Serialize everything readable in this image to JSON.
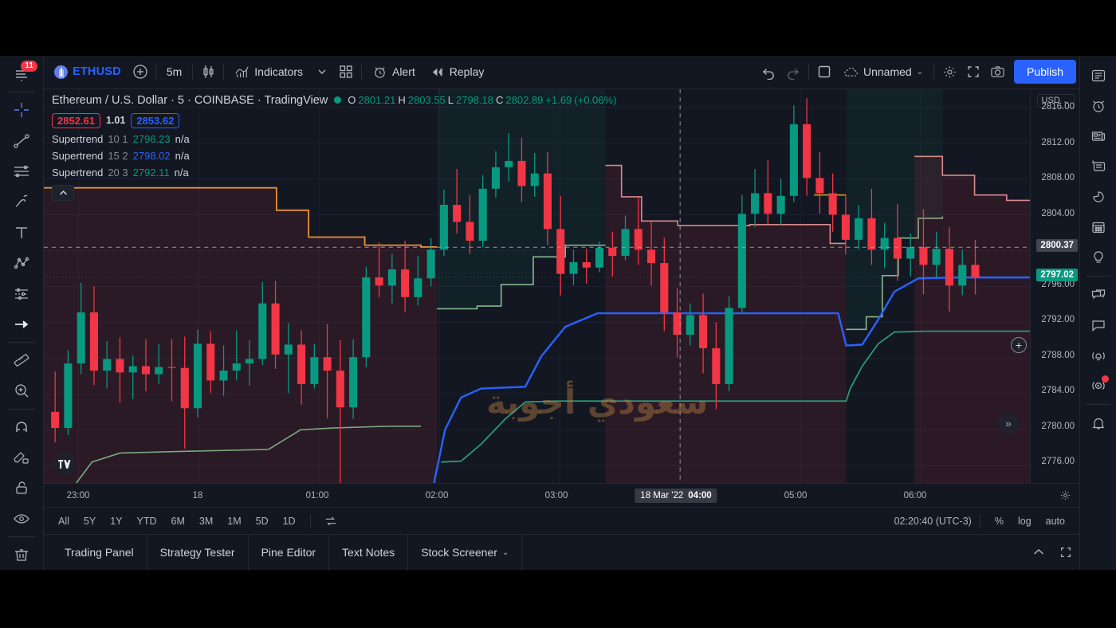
{
  "app": {
    "name": "TradingView",
    "theme_bg": "#131722",
    "accent": "#2962ff",
    "up_color": "#089981",
    "down_color": "#f23645"
  },
  "toolbar": {
    "symbol": "ETHUSD",
    "symbol_icon": "ethereum-coin-icon",
    "add_symbol": "+",
    "interval": "5m",
    "chart_type_icon": "candles-icon",
    "indicators_label": "Indicators",
    "indicators_caret": "⌄",
    "templates_icon": "grid-icon",
    "alert_label": "Alert",
    "replay_label": "Replay",
    "undo_icon": "undo-icon",
    "redo_icon": "redo-icon",
    "layout_icon": "layout-icon",
    "save_state": "Unnamed",
    "save_caret": "⌄",
    "settings_icon": "gear-icon",
    "fullscreen_icon": "fullscreen-icon",
    "snapshot_icon": "camera-icon",
    "publish_label": "Publish"
  },
  "left_tools": [
    {
      "name": "menu-icon",
      "badge": "11"
    },
    {
      "name": "crosshair-icon",
      "badge": ""
    },
    {
      "name": "trend-line-icon",
      "badge": ""
    },
    {
      "name": "horizontal-lines-icon",
      "badge": ""
    },
    {
      "name": "brush-icon",
      "badge": ""
    },
    {
      "name": "text-tool-icon",
      "badge": ""
    },
    {
      "name": "patterns-icon",
      "badge": ""
    },
    {
      "name": "prediction-icon",
      "badge": ""
    },
    {
      "name": "arrow-icon",
      "badge": ""
    },
    {
      "name": "measure-ruler-icon",
      "badge": ""
    },
    {
      "name": "zoom-in-icon",
      "badge": ""
    },
    {
      "name": "magnet-icon",
      "badge": ""
    },
    {
      "name": "stay-in-drawing-mode-icon",
      "badge": ""
    },
    {
      "name": "lock-drawings-icon",
      "badge": ""
    },
    {
      "name": "hide-drawings-icon",
      "badge": ""
    },
    {
      "name": "remove-drawings-icon",
      "badge": ""
    }
  ],
  "right_tools": [
    {
      "name": "watchlist-icon",
      "dot": false
    },
    {
      "name": "alerts-clock-icon",
      "dot": false
    },
    {
      "name": "news-icon",
      "dot": false
    },
    {
      "name": "data-window-icon",
      "dot": false
    },
    {
      "name": "hotlist-icon",
      "dot": false
    },
    {
      "name": "calendar-icon",
      "dot": false
    },
    {
      "name": "ideas-bulb-icon",
      "dot": false
    },
    {
      "name": "public-chats-icon",
      "dot": false
    },
    {
      "name": "private-chats-icon",
      "dot": false
    },
    {
      "name": "broadcast-icon",
      "dot": false
    },
    {
      "name": "stream-icon",
      "dot": true
    },
    {
      "name": "notifications-bell-icon",
      "dot": false
    }
  ],
  "legend": {
    "title": "Ethereum / U.S. Dollar · 5 · COINBASE · TradingView",
    "live_dot": "market-open-dot",
    "ohlc": {
      "o_label": "O",
      "o": "2801.21",
      "h_label": "H",
      "h": "2803.55",
      "l_label": "L",
      "l": "2798.18",
      "c_label": "C",
      "c": "2802.89",
      "change": "+1.69",
      "change_pct": "(+0.06%)"
    },
    "bid": "2852.61",
    "spread": "1.01",
    "ask": "2853.62",
    "indicators": [
      {
        "name": "Supertrend",
        "params": "10 1",
        "value": "2796.23",
        "value_color": "#089981",
        "extra": "n/a"
      },
      {
        "name": "Supertrend",
        "params": "15 2",
        "value": "2798.02",
        "value_color": "#2962ff",
        "extra": "n/a"
      },
      {
        "name": "Supertrend",
        "params": "20 3",
        "value": "2792.11",
        "value_color": "#089981",
        "extra": "n/a"
      }
    ],
    "collapse_icon": "chevron-up-icon",
    "watermark_logo": "tradingview-logo-icon",
    "overlay_watermark": "سعودي أجوبة"
  },
  "price_axis": {
    "currency": "USD",
    "currency_caret": "⌄",
    "ticks": [
      "2816.00",
      "2812.00",
      "2808.00",
      "2804.00",
      "2800.00",
      "2796.00",
      "2792.00",
      "2788.00",
      "2784.00",
      "2780.00",
      "2776.00"
    ],
    "crosshair_price": "2800.37",
    "last_price": "2797.02"
  },
  "time_axis": {
    "ticks": [
      "23:00",
      "18",
      "01:00",
      "02:00",
      "03:00",
      "05:00",
      "06:00"
    ],
    "active_date": "18 Mar '22",
    "active_time": "04:00",
    "settings_icon": "gear-icon"
  },
  "ranges": {
    "buttons": [
      "1D",
      "5D",
      "1M",
      "3M",
      "6M",
      "YTD",
      "1Y",
      "5Y",
      "All"
    ],
    "goto_icon": "go-to-date-icon",
    "clock": "02:20:40 (UTC-3)",
    "percent_label": "%",
    "log_label": "log",
    "auto_label": "auto"
  },
  "footer": {
    "tabs": [
      {
        "label": "Stock Screener",
        "caret": "⌄"
      },
      {
        "label": "Text Notes",
        "caret": ""
      },
      {
        "label": "Pine Editor",
        "caret": ""
      },
      {
        "label": "Strategy Tester",
        "caret": ""
      },
      {
        "label": "Trading Panel",
        "caret": ""
      }
    ],
    "collapse_icon": "chevron-up-icon",
    "fullscreen_icon": "fullscreen-icon"
  },
  "chart_data": {
    "type": "candlestick",
    "title": "Ethereum / U.S. Dollar · 5 · COINBASE",
    "xlabel": "",
    "ylabel": "USD",
    "ylim": [
      2774.0,
      2818.0
    ],
    "grid": true,
    "legend_position": "top-left",
    "y_ticks": [
      2816.0,
      2812.0,
      2808.0,
      2804.0,
      2800.0,
      2796.0,
      2792.0,
      2788.0,
      2784.0,
      2780.0,
      2776.0
    ],
    "x_ticks": [
      "23:00",
      "18",
      "01:00",
      "02:00",
      "03:00",
      "04:00",
      "05:00",
      "06:00"
    ],
    "last_price": 2797.02,
    "crosshair_price": 2800.37,
    "crosshair_time": "18 Mar '22 04:00",
    "candles": [
      {
        "o": 2782.0,
        "h": 2786.5,
        "c": 2780.2,
        "l": 2778.6
      },
      {
        "o": 2780.2,
        "h": 2788.9,
        "c": 2787.4,
        "l": 2779.4
      },
      {
        "o": 2787.4,
        "h": 2796.4,
        "c": 2793.1,
        "l": 2786.2
      },
      {
        "o": 2793.1,
        "h": 2796.0,
        "c": 2786.6,
        "l": 2785.0
      },
      {
        "o": 2786.6,
        "h": 2789.9,
        "c": 2787.9,
        "l": 2784.6
      },
      {
        "o": 2787.9,
        "h": 2790.3,
        "c": 2786.4,
        "l": 2783.0
      },
      {
        "o": 2786.4,
        "h": 2788.3,
        "c": 2787.1,
        "l": 2783.4
      },
      {
        "o": 2787.1,
        "h": 2790.1,
        "c": 2786.2,
        "l": 2784.3
      },
      {
        "o": 2786.2,
        "h": 2789.6,
        "c": 2787.0,
        "l": 2785.1
      },
      {
        "o": 2787.0,
        "h": 2790.1,
        "c": 2786.9,
        "l": 2783.2
      },
      {
        "o": 2786.9,
        "h": 2790.4,
        "c": 2782.4,
        "l": 2777.9
      },
      {
        "o": 2782.4,
        "h": 2791.2,
        "c": 2789.6,
        "l": 2781.4
      },
      {
        "o": 2789.6,
        "h": 2791.0,
        "c": 2785.5,
        "l": 2784.1
      },
      {
        "o": 2785.5,
        "h": 2789.4,
        "c": 2786.6,
        "l": 2783.8
      },
      {
        "o": 2786.6,
        "h": 2791.1,
        "c": 2787.4,
        "l": 2785.5
      },
      {
        "o": 2787.4,
        "h": 2790.0,
        "c": 2787.9,
        "l": 2784.9
      },
      {
        "o": 2787.9,
        "h": 2796.5,
        "c": 2794.1,
        "l": 2787.2
      },
      {
        "o": 2794.1,
        "h": 2796.6,
        "c": 2788.4,
        "l": 2786.8
      },
      {
        "o": 2788.4,
        "h": 2791.9,
        "c": 2789.5,
        "l": 2784.1
      },
      {
        "o": 2789.5,
        "h": 2791.1,
        "c": 2785.1,
        "l": 2782.8
      },
      {
        "o": 2785.1,
        "h": 2789.6,
        "c": 2788.1,
        "l": 2784.6
      },
      {
        "o": 2788.1,
        "h": 2791.8,
        "c": 2786.6,
        "l": 2781.3
      },
      {
        "o": 2786.6,
        "h": 2790.0,
        "c": 2782.5,
        "l": 2774.0
      },
      {
        "o": 2782.5,
        "h": 2790.1,
        "c": 2788.1,
        "l": 2781.2
      },
      {
        "o": 2788.1,
        "h": 2798.2,
        "c": 2797.0,
        "l": 2787.0
      },
      {
        "o": 2797.0,
        "h": 2800.9,
        "c": 2796.1,
        "l": 2794.8
      },
      {
        "o": 2796.1,
        "h": 2799.6,
        "c": 2797.9,
        "l": 2794.1
      },
      {
        "o": 2797.9,
        "h": 2801.1,
        "c": 2794.8,
        "l": 2793.1
      },
      {
        "o": 2794.8,
        "h": 2799.4,
        "c": 2796.9,
        "l": 2793.9
      },
      {
        "o": 2796.9,
        "h": 2801.4,
        "c": 2800.1,
        "l": 2796.0
      },
      {
        "o": 2800.1,
        "h": 2806.8,
        "c": 2805.1,
        "l": 2799.4
      },
      {
        "o": 2805.1,
        "h": 2809.1,
        "c": 2803.2,
        "l": 2801.9
      },
      {
        "o": 2803.2,
        "h": 2806.2,
        "c": 2801.1,
        "l": 2799.6
      },
      {
        "o": 2801.1,
        "h": 2808.4,
        "c": 2806.9,
        "l": 2800.4
      },
      {
        "o": 2806.9,
        "h": 2811.1,
        "c": 2809.3,
        "l": 2805.9
      },
      {
        "o": 2809.3,
        "h": 2813.1,
        "c": 2810.0,
        "l": 2807.7
      },
      {
        "o": 2810.0,
        "h": 2812.6,
        "c": 2807.2,
        "l": 2805.4
      },
      {
        "o": 2807.2,
        "h": 2810.9,
        "c": 2808.6,
        "l": 2806.0
      },
      {
        "o": 2808.6,
        "h": 2811.0,
        "c": 2802.4,
        "l": 2800.6
      },
      {
        "o": 2802.4,
        "h": 2806.1,
        "c": 2797.4,
        "l": 2795.0
      },
      {
        "o": 2797.4,
        "h": 2800.1,
        "c": 2798.7,
        "l": 2796.1
      },
      {
        "o": 2798.7,
        "h": 2800.2,
        "c": 2798.1,
        "l": 2796.3
      },
      {
        "o": 2798.1,
        "h": 2801.0,
        "c": 2800.3,
        "l": 2797.6
      },
      {
        "o": 2800.3,
        "h": 2802.1,
        "c": 2799.4,
        "l": 2797.1
      },
      {
        "o": 2799.4,
        "h": 2803.9,
        "c": 2802.4,
        "l": 2798.9
      },
      {
        "o": 2802.4,
        "h": 2806.0,
        "c": 2800.1,
        "l": 2798.4
      },
      {
        "o": 2800.1,
        "h": 2803.2,
        "c": 2798.6,
        "l": 2796.1
      },
      {
        "o": 2798.6,
        "h": 2801.4,
        "c": 2793.1,
        "l": 2791.0
      },
      {
        "o": 2793.1,
        "h": 2795.8,
        "c": 2790.6,
        "l": 2788.1
      },
      {
        "o": 2790.6,
        "h": 2794.1,
        "c": 2792.8,
        "l": 2789.4
      },
      {
        "o": 2792.8,
        "h": 2795.2,
        "c": 2789.1,
        "l": 2786.3
      },
      {
        "o": 2789.1,
        "h": 2792.0,
        "c": 2785.1,
        "l": 2782.3
      },
      {
        "o": 2785.1,
        "h": 2794.9,
        "c": 2793.6,
        "l": 2784.3
      },
      {
        "o": 2793.6,
        "h": 2806.2,
        "c": 2804.1,
        "l": 2793.0
      },
      {
        "o": 2804.1,
        "h": 2809.1,
        "c": 2806.4,
        "l": 2802.6
      },
      {
        "o": 2806.4,
        "h": 2810.1,
        "c": 2804.1,
        "l": 2803.0
      },
      {
        "o": 2804.1,
        "h": 2808.0,
        "c": 2806.1,
        "l": 2802.9
      },
      {
        "o": 2806.1,
        "h": 2816.2,
        "c": 2814.1,
        "l": 2805.4
      },
      {
        "o": 2814.1,
        "h": 2817.0,
        "c": 2808.1,
        "l": 2806.1
      },
      {
        "o": 2808.1,
        "h": 2811.0,
        "c": 2806.4,
        "l": 2804.1
      },
      {
        "o": 2806.4,
        "h": 2808.6,
        "c": 2804.0,
        "l": 2802.1
      },
      {
        "o": 2804.0,
        "h": 2806.2,
        "c": 2801.2,
        "l": 2799.6
      },
      {
        "o": 2801.2,
        "h": 2805.1,
        "c": 2803.6,
        "l": 2800.1
      },
      {
        "o": 2803.6,
        "h": 2806.9,
        "c": 2800.1,
        "l": 2798.4
      },
      {
        "o": 2800.1,
        "h": 2803.1,
        "c": 2801.4,
        "l": 2798.0
      },
      {
        "o": 2801.4,
        "h": 2805.2,
        "c": 2799.1,
        "l": 2796.6
      },
      {
        "o": 2799.1,
        "h": 2801.9,
        "c": 2800.4,
        "l": 2797.1
      },
      {
        "o": 2800.4,
        "h": 2804.6,
        "c": 2798.4,
        "l": 2795.1
      },
      {
        "o": 2798.4,
        "h": 2802.1,
        "c": 2800.2,
        "l": 2796.9
      },
      {
        "o": 2800.2,
        "h": 2802.6,
        "c": 2796.1,
        "l": 2793.2
      },
      {
        "o": 2796.1,
        "h": 2800.1,
        "c": 2798.4,
        "l": 2795.0
      },
      {
        "o": 2798.4,
        "h": 2801.2,
        "c": 2797.02,
        "l": 2795.1
      }
    ],
    "series": [
      {
        "name": "Supertrend 10 1",
        "color": "#089981",
        "last_value": 2796.23
      },
      {
        "name": "Supertrend 15 2",
        "color": "#2962ff",
        "last_value": 2798.02
      },
      {
        "name": "Supertrend 20 3",
        "color": "#089981",
        "last_value": 2792.11
      }
    ]
  }
}
